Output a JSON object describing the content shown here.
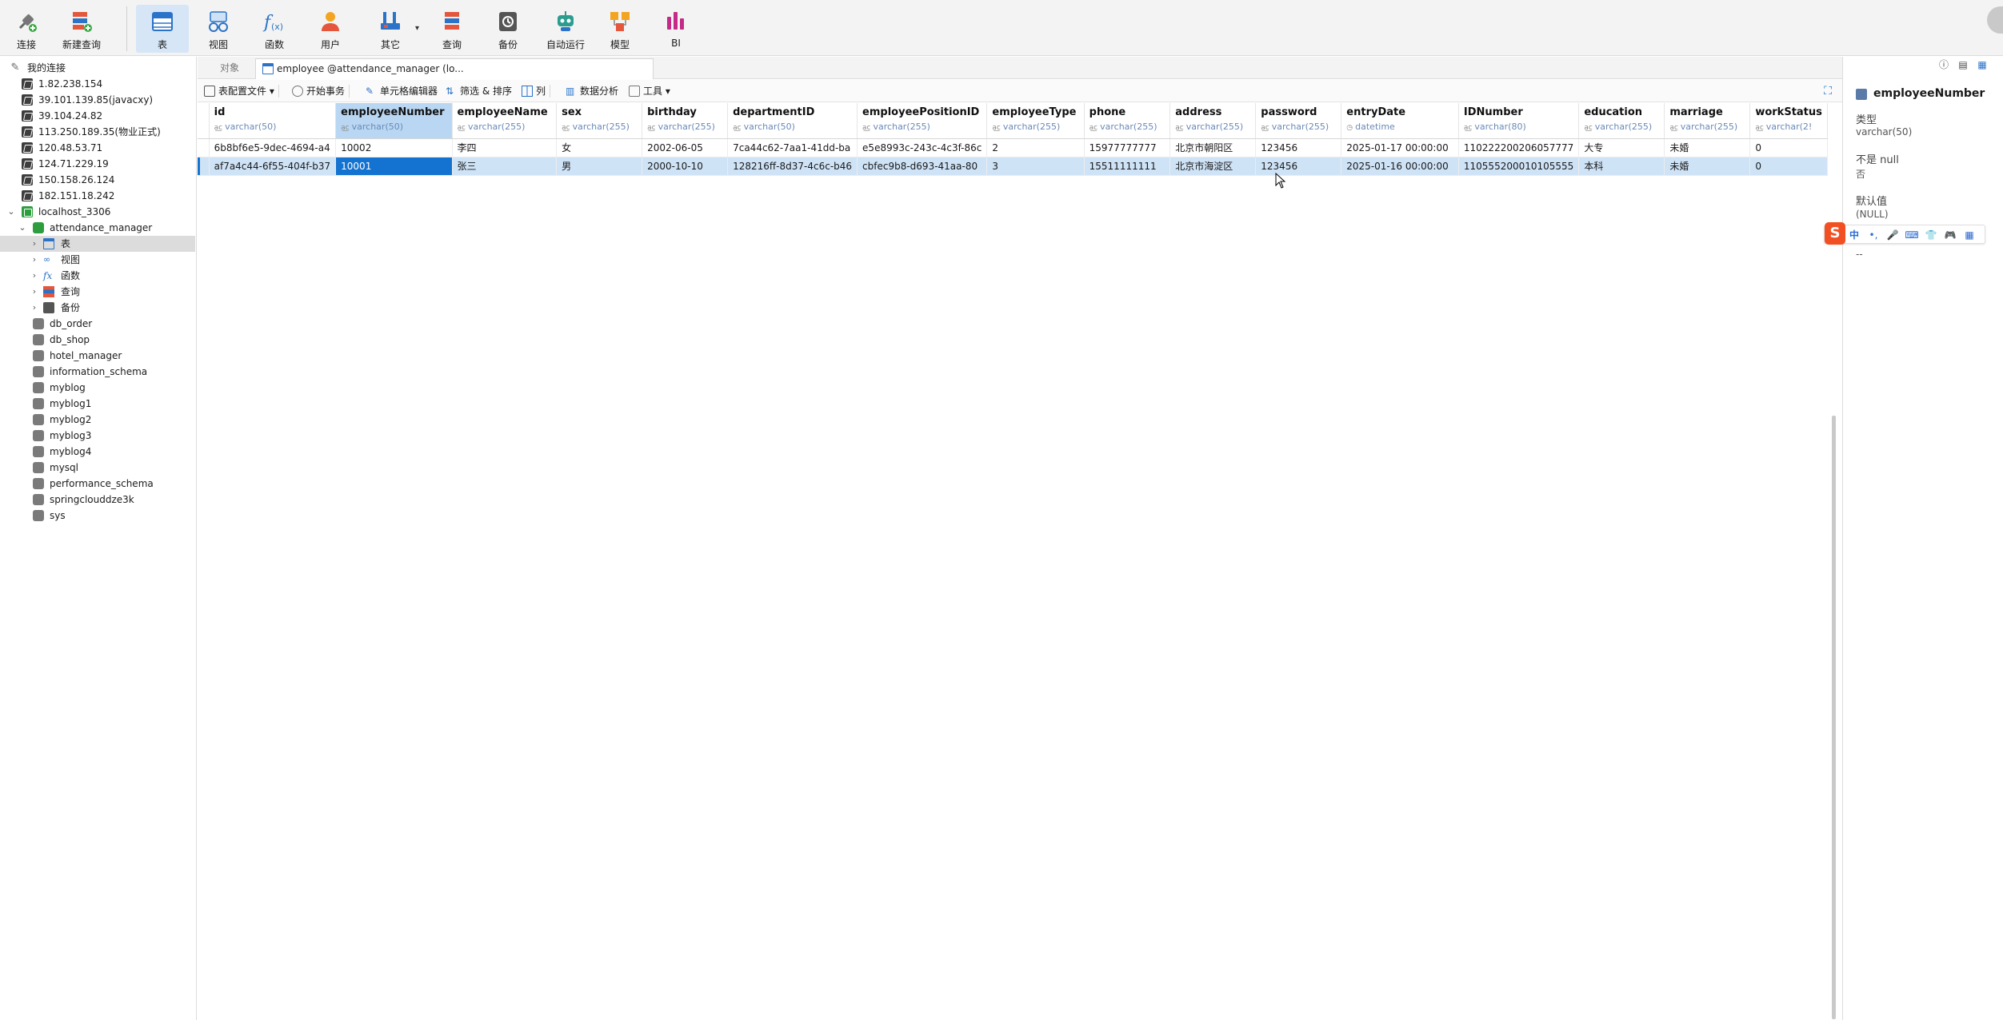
{
  "toolbar": {
    "buttons": [
      {
        "label": "连接",
        "icon": "plug-connect-icon"
      },
      {
        "label": "新建查询",
        "icon": "new-query-icon"
      },
      {
        "label": "表",
        "icon": "table-icon",
        "active": true
      },
      {
        "label": "视图",
        "icon": "view-glasses-icon"
      },
      {
        "label": "函数",
        "icon": "function-fx-icon"
      },
      {
        "label": "用户",
        "icon": "user-icon"
      },
      {
        "label": "其它",
        "icon": "tools-icon"
      },
      {
        "label": "查询",
        "icon": "query-icon"
      },
      {
        "label": "备份",
        "icon": "backup-icon"
      },
      {
        "label": "自动运行",
        "icon": "robot-icon"
      },
      {
        "label": "模型",
        "icon": "model-icon"
      },
      {
        "label": "BI",
        "icon": "bi-chart-icon"
      }
    ]
  },
  "sidebar": {
    "header": "我的连接",
    "connections": [
      "1.82.238.154",
      "39.101.139.85(javacxy)",
      "39.104.24.82",
      "113.250.189.35(物业正式)",
      "120.48.53.71",
      "124.71.229.19",
      "150.158.26.124",
      "182.151.18.242"
    ],
    "localhost": "localhost_3306",
    "open_db": "attendance_manager",
    "open_db_children": [
      "表",
      "视图",
      "函数",
      "查询",
      "备份"
    ],
    "databases": [
      "db_order",
      "db_shop",
      "hotel_manager",
      "information_schema",
      "myblog",
      "myblog1",
      "myblog2",
      "myblog3",
      "myblog4",
      "mysql",
      "performance_schema",
      "springclouddze3k",
      "sys"
    ]
  },
  "tabs": {
    "objects": "对象",
    "active": "employee @attendance_manager (lo..."
  },
  "subtoolbar": {
    "table_profile": "表配置文件",
    "begin_tx": "开始事务",
    "cell_editor": "单元格编辑器",
    "filter_sort": "筛选 & 排序",
    "columns": "列",
    "data_analysis": "数据分析",
    "tools": "工具"
  },
  "grid": {
    "columns": [
      {
        "name": "id",
        "type": "varchar(50)",
        "kind": "str"
      },
      {
        "name": "employeeNumber",
        "type": "varchar(50)",
        "kind": "str"
      },
      {
        "name": "employeeName",
        "type": "varchar(255)",
        "kind": "str"
      },
      {
        "name": "sex",
        "type": "varchar(255)",
        "kind": "str"
      },
      {
        "name": "birthday",
        "type": "varchar(255)",
        "kind": "str"
      },
      {
        "name": "departmentID",
        "type": "varchar(50)",
        "kind": "str"
      },
      {
        "name": "employeePositionID",
        "type": "varchar(255)",
        "kind": "str"
      },
      {
        "name": "employeeType",
        "type": "varchar(255)",
        "kind": "str"
      },
      {
        "name": "phone",
        "type": "varchar(255)",
        "kind": "str"
      },
      {
        "name": "address",
        "type": "varchar(255)",
        "kind": "str"
      },
      {
        "name": "password",
        "type": "varchar(255)",
        "kind": "str"
      },
      {
        "name": "entryDate",
        "type": "datetime",
        "kind": "time"
      },
      {
        "name": "IDNumber",
        "type": "varchar(80)",
        "kind": "str"
      },
      {
        "name": "education",
        "type": "varchar(255)",
        "kind": "str"
      },
      {
        "name": "marriage",
        "type": "varchar(255)",
        "kind": "str"
      },
      {
        "name": "workStatus",
        "type": "varchar(2!",
        "kind": "str"
      }
    ],
    "selected_column": "employeeNumber",
    "rows": [
      [
        "6b8bf6e5-9dec-4694-a4",
        "10002",
        "李四",
        "女",
        "2002-06-05",
        "7ca44c62-7aa1-41dd-ba",
        "e5e8993c-243c-4c3f-86c",
        "2",
        "15977777777",
        "北京市朝阳区",
        "123456",
        "2025-01-17 00:00:00",
        "110222200206057777",
        "大专",
        "未婚",
        "0"
      ],
      [
        "af7a4c44-6f55-404f-b37",
        "10001",
        "张三",
        "男",
        "2000-10-10",
        "128216ff-8d37-4c6c-b46",
        "cbfec9b8-d693-41aa-80",
        "3",
        "15511111111",
        "北京市海淀区",
        "123456",
        "2025-01-16 00:00:00",
        "110555200010105555",
        "本科",
        "未婚",
        "0"
      ]
    ]
  },
  "rightpanel": {
    "field_name": "employeeNumber",
    "type_label": "类型",
    "type_value": "varchar(50)",
    "notnull_label": "不是 null",
    "notnull_value": "否",
    "default_label": "默认值",
    "default_value": "(NULL)",
    "comment_value": "--"
  },
  "ime": {
    "logo": "S",
    "items": [
      "中",
      "•,",
      "🎤",
      "⌨",
      "👕",
      "🎮",
      "▦"
    ]
  },
  "colors": {
    "accent": "#1473d0",
    "selected_row": "#cfe3f7",
    "selected_col_header": "#b9d7f3",
    "active_toolbar": "#d6e6f7"
  }
}
